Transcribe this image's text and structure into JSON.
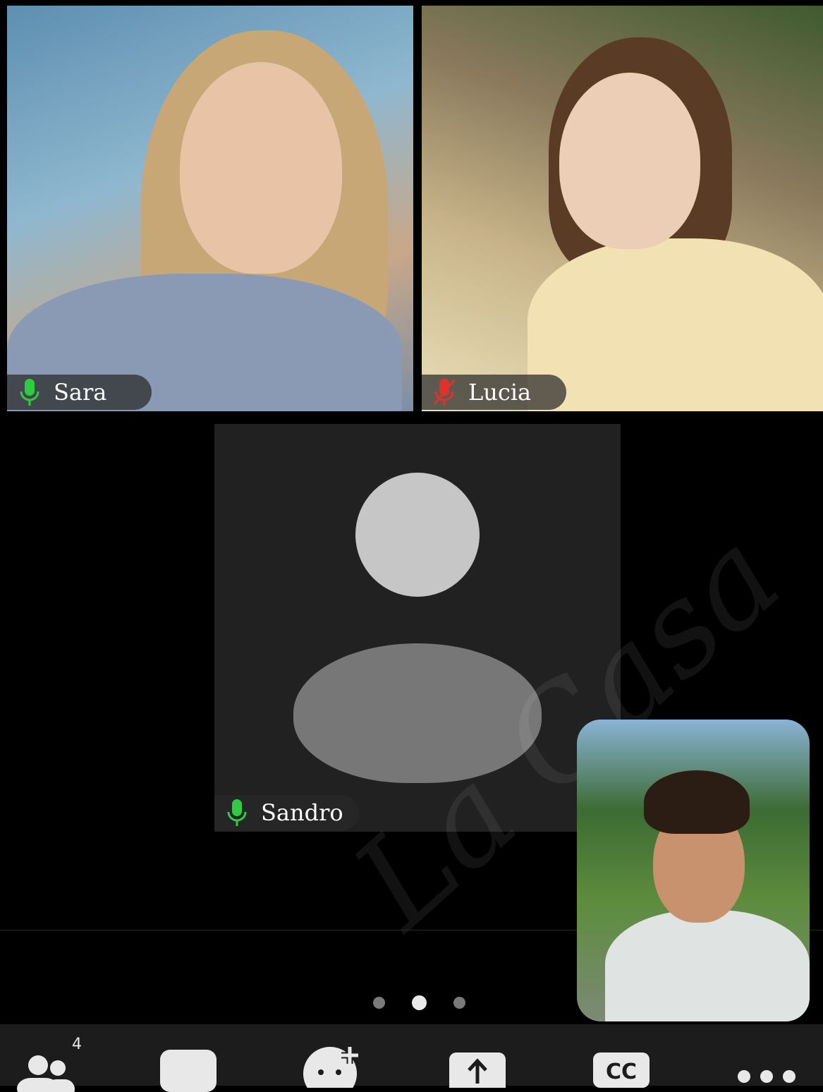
{
  "participants": {
    "sara": {
      "name": "Sara",
      "mic": "mic-on-icon"
    },
    "lucia": {
      "name": "Lucia",
      "mic": "mic-muted-icon"
    },
    "sandro": {
      "name": "Sandro",
      "mic": "mic-on-icon"
    }
  },
  "watermark": "La Casa",
  "pagination": {
    "pages": 3,
    "active_page": 2
  },
  "toolbar": {
    "participants_count": "4",
    "buttons": [
      "participants-icon",
      "chat-icon",
      "reactions-icon",
      "share-icon",
      "cc-icon",
      "more-icon"
    ],
    "cc_label": "CC"
  },
  "colors": {
    "mic_on": "#2ecc40",
    "mic_muted": "#e0322b",
    "background": "#000000",
    "toolbar": "#1c1c1c"
  }
}
